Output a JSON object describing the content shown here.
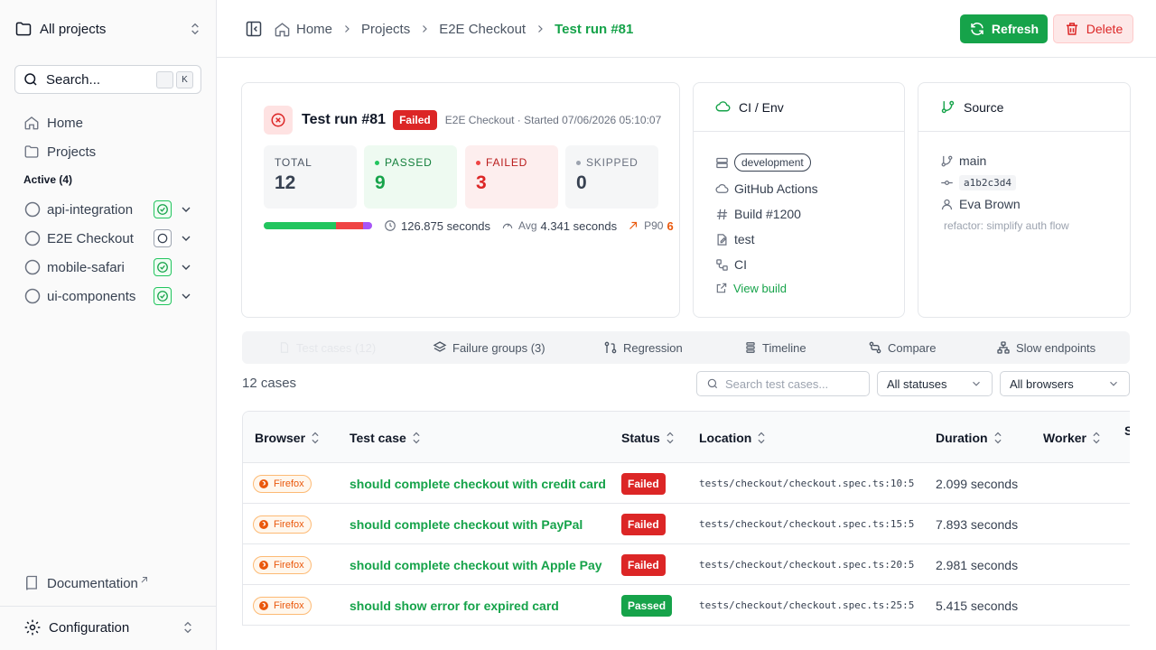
{
  "sidebar": {
    "project_switcher": "All projects",
    "search": {
      "placeholder": "Search...",
      "kbd": "K"
    },
    "nav": [
      {
        "label": "Home",
        "icon": "home-icon"
      },
      {
        "label": "Projects",
        "icon": "folder-icon"
      }
    ],
    "active_heading": "Active (4)",
    "projects": [
      {
        "name": "api-integration",
        "status": "passed"
      },
      {
        "name": "E2E Checkout",
        "status": "running"
      },
      {
        "name": "mobile-safari",
        "status": "passed"
      },
      {
        "name": "ui-components",
        "status": "passed"
      }
    ],
    "documentation": "Documentation",
    "configuration": "Configuration"
  },
  "header": {
    "breadcrumbs": [
      "Home",
      "Projects",
      "E2E Checkout",
      "Test run #81"
    ],
    "refresh_label": "Refresh",
    "delete_label": "Delete"
  },
  "run": {
    "title": "Test run #81",
    "status": "Failed",
    "meta": "E2E Checkout · Started 07/06/2026 05:10:07",
    "stats": {
      "total_label": "TOTAL",
      "total": "12",
      "passed_label": "PASSED",
      "passed": "9",
      "failed_label": "FAILED",
      "failed": "3",
      "skipped_label": "SKIPPED",
      "skipped": "0"
    },
    "progress": {
      "passed_pct": 67,
      "failed_pct": 25,
      "other_pct": 8
    },
    "duration": "126.875 seconds",
    "avg_label": "Avg",
    "avg": "4.341 seconds",
    "p90_label": "P90",
    "p90_value": "6"
  },
  "env": {
    "title": "CI / Env",
    "environment": "development",
    "provider": "GitHub Actions",
    "build": "Build #1200",
    "job": "test",
    "pipeline": "CI",
    "view_build": "View build"
  },
  "source": {
    "title": "Source",
    "branch": "main",
    "commit": "a1b2c3d4",
    "author": "Eva Brown",
    "message": "refactor: simplify auth flow"
  },
  "tabs": [
    {
      "label": "Test cases (12)",
      "icon": "file-icon",
      "active": true
    },
    {
      "label": "Failure groups (3)",
      "icon": "layers-icon",
      "active": false
    },
    {
      "label": "Regression",
      "icon": "git-compare-icon",
      "active": false
    },
    {
      "label": "Timeline",
      "icon": "timeline-icon",
      "active": false
    },
    {
      "label": "Compare",
      "icon": "compare-icon",
      "active": false
    },
    {
      "label": "Slow endpoints",
      "icon": "network-icon",
      "active": false
    }
  ],
  "filters": {
    "count": "12 cases",
    "search_placeholder": "Search test cases...",
    "status_select": "All statuses",
    "browser_select": "All browsers"
  },
  "table": {
    "columns": [
      "Browser",
      "Test case",
      "Status",
      "Location",
      "Duration",
      "Worker",
      "S"
    ],
    "rows": [
      {
        "browser": "Firefox",
        "name": "should complete checkout with credit card",
        "status": "Failed",
        "location": "tests/checkout/checkout.spec.ts:10:5",
        "duration": "2.099 seconds"
      },
      {
        "browser": "Firefox",
        "name": "should complete checkout with PayPal",
        "status": "Failed",
        "location": "tests/checkout/checkout.spec.ts:15:5",
        "duration": "7.893 seconds"
      },
      {
        "browser": "Firefox",
        "name": "should complete checkout with Apple Pay",
        "status": "Failed",
        "location": "tests/checkout/checkout.spec.ts:20:5",
        "duration": "2.981 seconds"
      },
      {
        "browser": "Firefox",
        "name": "should show error for expired card",
        "status": "Passed",
        "location": "tests/checkout/checkout.spec.ts:25:5",
        "duration": "5.415 seconds"
      }
    ]
  },
  "colors": {
    "accent": "#16a34a",
    "danger": "#dc2626",
    "firefox": "#ea580c",
    "skipped": "#a855f7"
  }
}
